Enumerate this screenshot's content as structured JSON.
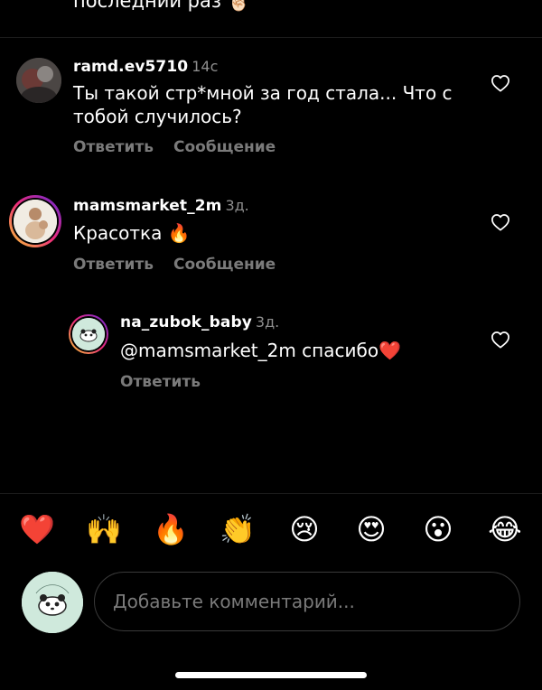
{
  "previous_comment": {
    "text_tail": "последний раз",
    "emoji": "☝🏻"
  },
  "comments": [
    {
      "username": "ramd.ev5710",
      "time": "14с",
      "text": "Ты такой стр*мной за год стала... Что с тобой случилось?",
      "reply_label": "Ответить",
      "message_label": "Сообщение"
    },
    {
      "username": "mamsmarket_2m",
      "time": "3д.",
      "text": "Красотка",
      "emoji": "🔥",
      "reply_label": "Ответить",
      "message_label": "Сообщение"
    },
    {
      "username": "na_zubok_baby",
      "time": "3д.",
      "text": "@mamsmarket_2m спасибо",
      "emoji": "❤️",
      "reply_label": "Ответить"
    }
  ],
  "emoji_bar": [
    "❤️",
    "🙌",
    "🔥",
    "👏",
    "😢",
    "😍",
    "😮",
    "😂"
  ],
  "input": {
    "placeholder": "Добавьте комментарий..."
  },
  "colors": {
    "background": "#000000",
    "secondary_text": "#8e8e8e",
    "action_text": "#7a7a7a",
    "story_ring": "#d62976"
  }
}
